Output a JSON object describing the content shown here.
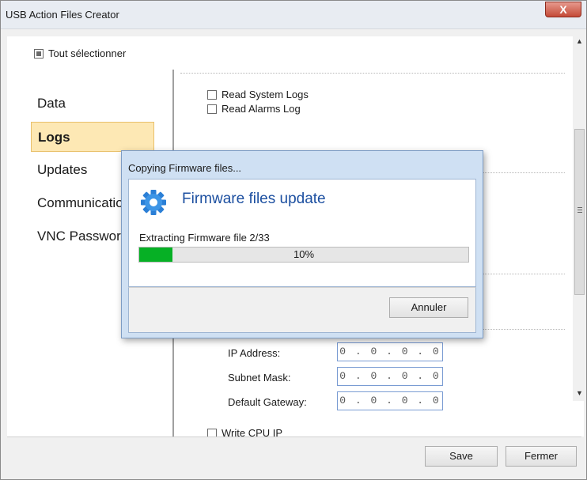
{
  "window": {
    "title": "USB Action Files Creator",
    "close_glyph": "X"
  },
  "select_all": {
    "label": "Tout sélectionner",
    "state": "partial"
  },
  "nav": {
    "items": [
      {
        "label": "Data",
        "selected": false
      },
      {
        "label": "Logs",
        "selected": true
      },
      {
        "label": "Updates",
        "selected": false
      },
      {
        "label": "Communication",
        "selected": false
      },
      {
        "label": "VNC Password",
        "selected": false
      }
    ]
  },
  "panel": {
    "options": [
      {
        "label": "Read System Logs",
        "checked": false
      },
      {
        "label": "Read Alarms Log",
        "checked": false
      },
      {
        "label": "Write CPU IP",
        "checked": false
      }
    ],
    "ip_fields": [
      {
        "label": "IP Address:",
        "value": "0 . 0 . 0 . 0"
      },
      {
        "label": "Subnet Mask:",
        "value": "0 . 0 . 0 . 0"
      },
      {
        "label": "Default Gateway:",
        "value": "0 . 0 . 0 . 0"
      }
    ]
  },
  "buttons": {
    "save": "Save",
    "close": "Fermer"
  },
  "dialog": {
    "title": "Copying Firmware files...",
    "heading": "Firmware files update",
    "status": "Extracting Firmware file 2/33",
    "progress_percent": 10,
    "progress_label": "10%",
    "cancel": "Annuler"
  },
  "colors": {
    "selected_nav_bg": "#fde8b4",
    "progress_fill": "#06b025",
    "heading_blue": "#1c4fa0"
  }
}
